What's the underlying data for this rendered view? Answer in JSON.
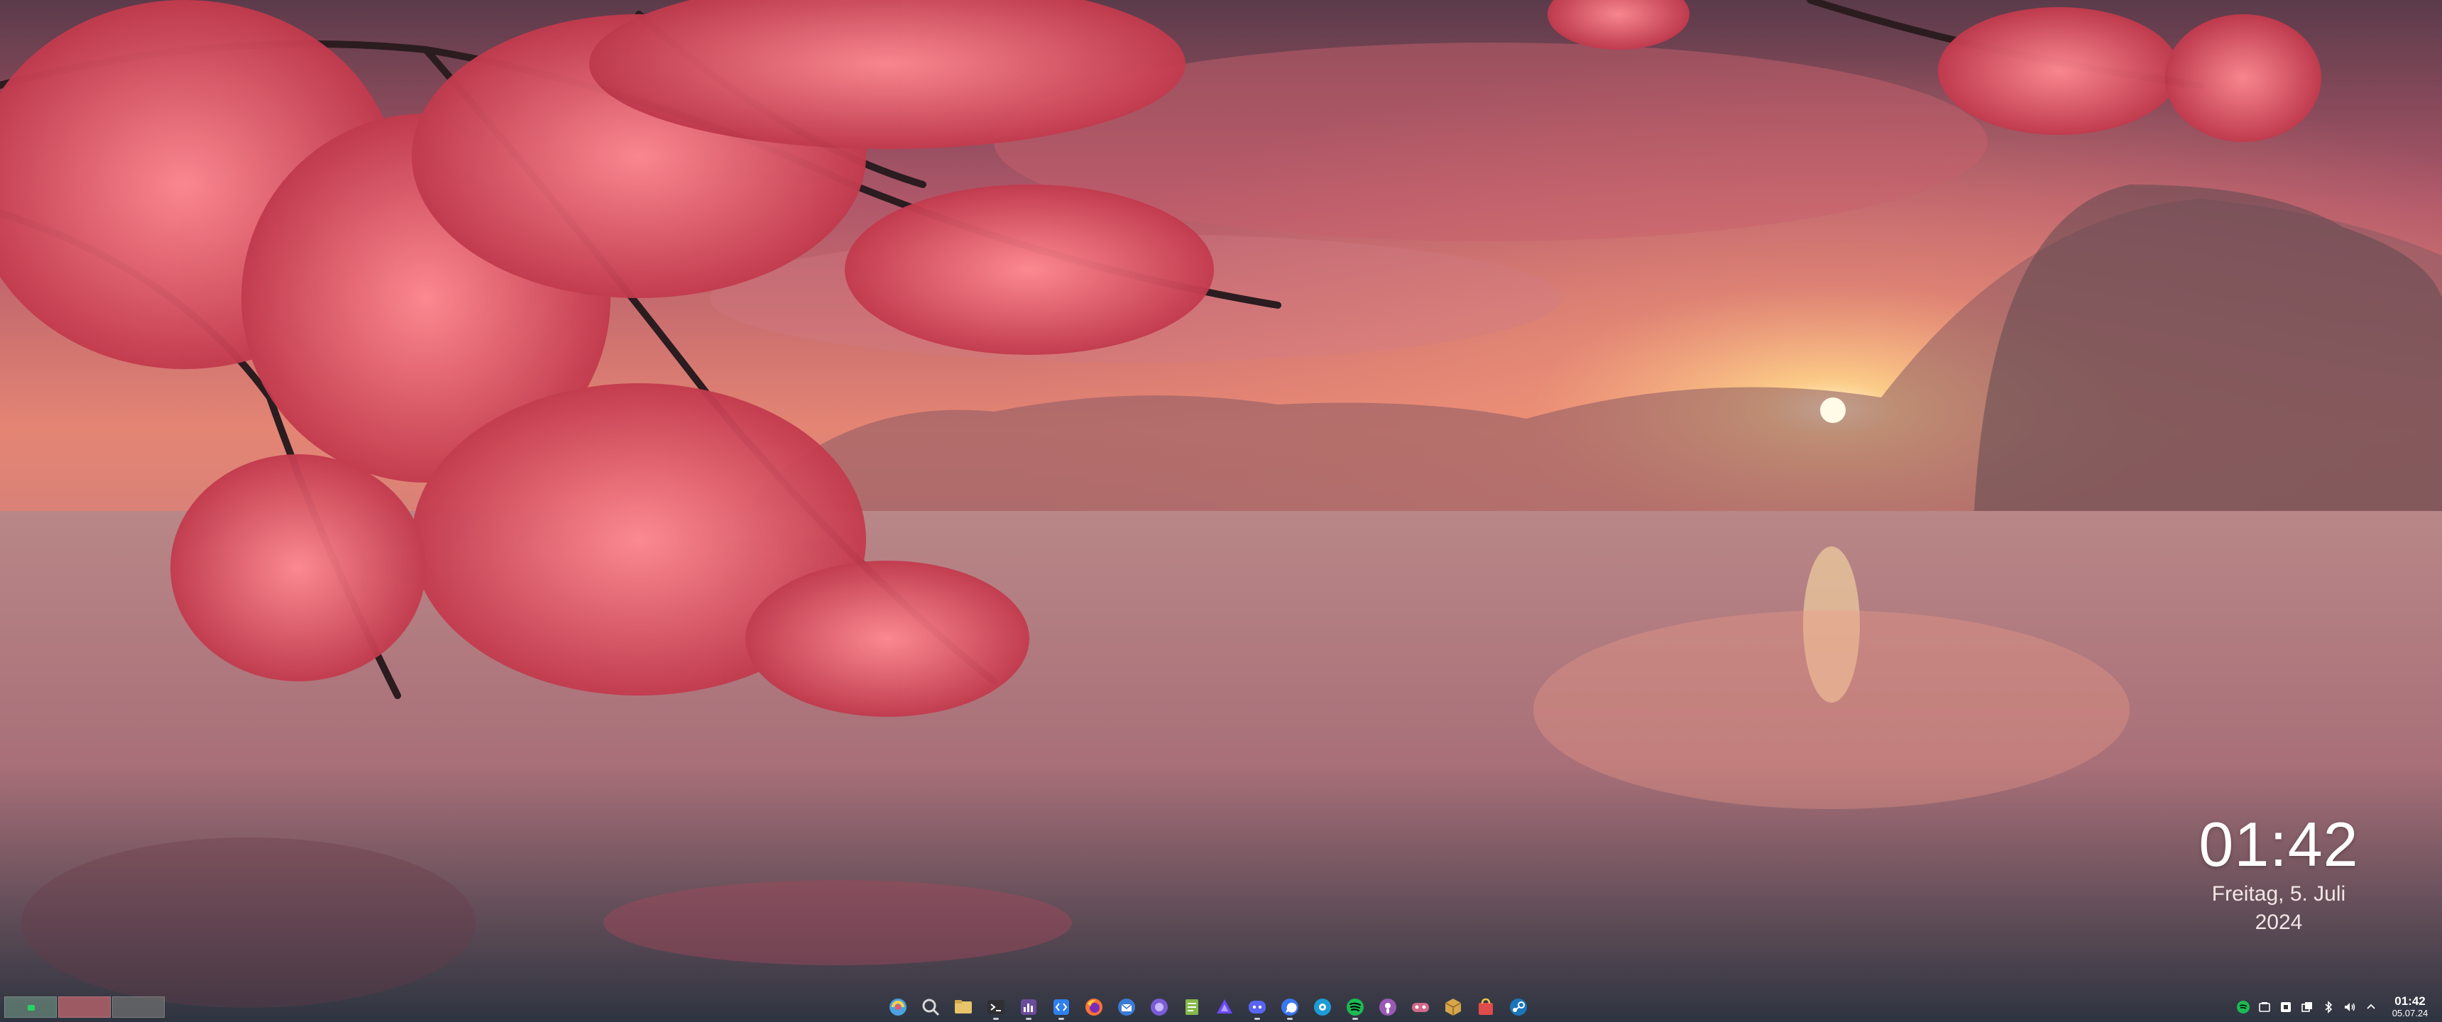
{
  "desktop": {
    "clock": {
      "time": "01:42",
      "date_line1": "Freitag, 5. Juli",
      "date_line2": "2024"
    }
  },
  "taskbar": {
    "pager": {
      "desktops": 3,
      "active_desktop": 1
    },
    "apps": [
      {
        "name": "app-launcher-icon",
        "color": "#4aa3df"
      },
      {
        "name": "search-icon",
        "color": "#cfcfcf"
      },
      {
        "name": "file-manager-icon",
        "color": "#e8c46a"
      },
      {
        "name": "terminal-icon",
        "color": "#3d3d3d"
      },
      {
        "name": "task-manager-icon",
        "color": "#6a4c9c"
      },
      {
        "name": "code-editor-icon",
        "color": "#2f80ed"
      },
      {
        "name": "firefox-icon",
        "color": "#ff7139"
      },
      {
        "name": "thunderbird-icon",
        "color": "#3a7bd5"
      },
      {
        "name": "browser-icon",
        "color": "#7b5cd6"
      },
      {
        "name": "notes-icon",
        "color": "#86b84a"
      },
      {
        "name": "proton-vpn-icon",
        "color": "#6d4aff"
      },
      {
        "name": "discord-icon",
        "color": "#5865f2"
      },
      {
        "name": "signal-icon",
        "color": "#3a76f0"
      },
      {
        "name": "network-icon",
        "color": "#1e9bd7"
      },
      {
        "name": "spotify-icon",
        "color": "#1db954"
      },
      {
        "name": "podcast-icon",
        "color": "#9b59b6"
      },
      {
        "name": "game-controller-icon",
        "color": "#d06a8a"
      },
      {
        "name": "package-icon",
        "color": "#d7a64a"
      },
      {
        "name": "store-icon",
        "color": "#e04b4b"
      },
      {
        "name": "steam-icon",
        "color": "#1b75bb"
      }
    ],
    "tray_icons": [
      {
        "name": "spotify-tray-icon",
        "color": "#1db954"
      },
      {
        "name": "clipboard-tray-icon",
        "color": "#ffffff"
      },
      {
        "name": "media-tray-icon",
        "color": "#ffffff"
      },
      {
        "name": "windows-tray-icon",
        "color": "#ffffff"
      },
      {
        "name": "bluetooth-tray-icon",
        "color": "#ffffff"
      },
      {
        "name": "volume-tray-icon",
        "color": "#ffffff"
      },
      {
        "name": "expand-tray-icon",
        "color": "#ffffff"
      }
    ],
    "clock": {
      "time": "01:42",
      "date": "05.07.24"
    }
  }
}
